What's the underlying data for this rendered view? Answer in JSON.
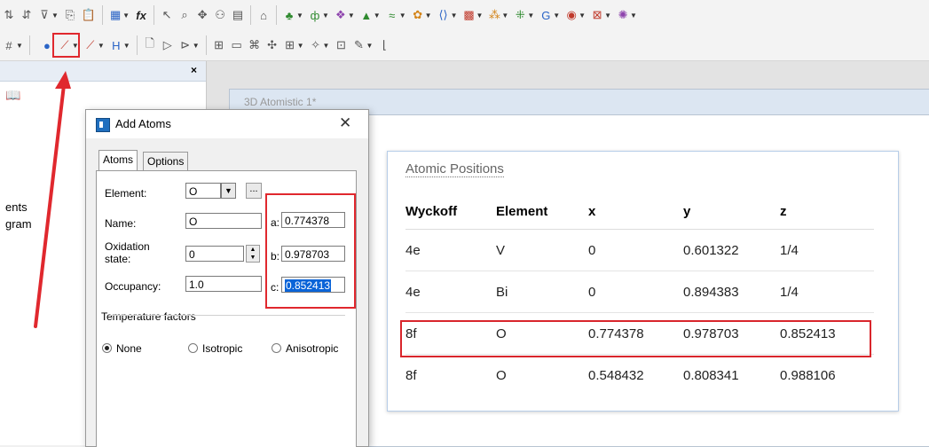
{
  "toolbar_top": {
    "icons": [
      "sort-asc-icon",
      "sort-desc-icon",
      "filter-icon",
      "copy-icon",
      "paste-icon",
      "insert-table-icon",
      "function-icon",
      "cursor-icon",
      "zoom-icon",
      "pan-icon",
      "structure-icon",
      "table-icon",
      "export-icon",
      "plot-green-icon",
      "phase-icon",
      "atoms-icon",
      "triangle-icon",
      "wave-icon",
      "cluster-icon",
      "bracket-icon",
      "grid-icon",
      "dots-icon",
      "grid2-icon",
      "graph-icon",
      "circle-icon",
      "crystal-icon",
      "molecule-icon",
      "settings-icon"
    ]
  },
  "toolbar_second": {
    "icons": [
      "hash-icon",
      "add-atom-icon",
      "add-bond-icon",
      "add-bond2-icon",
      "hydrogen-icon",
      "page-icon",
      "play-icon",
      "step-icon",
      "hierarchy-icon",
      "layout-icon",
      "tool1-icon",
      "tool2-icon",
      "tool3-icon",
      "tool4-icon",
      "tool5-icon",
      "tool6-icon",
      "chart-icon"
    ]
  },
  "left_panel": {
    "close_glyph": "×",
    "book_icon": "book-icon",
    "text_line_1": "ents",
    "text_line_2": "gram"
  },
  "document": {
    "tab_title": "3D Atomistic 1*"
  },
  "positions_card": {
    "title": "Atomic Positions",
    "headers": [
      "Wyckoff",
      "Element",
      "x",
      "y",
      "z"
    ],
    "rows": [
      [
        "4e",
        "V",
        "0",
        "0.601322",
        "1/4"
      ],
      [
        "4e",
        "Bi",
        "0",
        "0.894383",
        "1/4"
      ],
      [
        "8f",
        "O",
        "0.774378",
        "0.978703",
        "0.852413"
      ],
      [
        "8f",
        "O",
        "0.548432",
        "0.808341",
        "0.988106"
      ]
    ],
    "highlighted_row": 2
  },
  "dialog": {
    "title": "Add Atoms",
    "close_glyph": "✕",
    "tabs": [
      "Atoms",
      "Options"
    ],
    "element_label": "Element:",
    "element_value": "O",
    "browse_label": "...",
    "name_label": "Name:",
    "name_value": "O",
    "oxidation_label_1": "Oxidation",
    "oxidation_label_2": "state:",
    "oxidation_value": "0",
    "occupancy_label": "Occupancy:",
    "occupancy_value": "1.0",
    "a_label": "a:",
    "a_value": "0.774378",
    "b_label": "b:",
    "b_value": "0.978703",
    "c_label": "c:",
    "c_value": "0.852413",
    "temp_group": "Temperature factors",
    "radio_none": "None",
    "radio_iso": "Isotropic",
    "radio_aniso": "Anisotropic",
    "radio_selected": "None"
  },
  "annotation": {
    "highlight_color": "#e0282e",
    "arrow_color": "#e0282e"
  }
}
